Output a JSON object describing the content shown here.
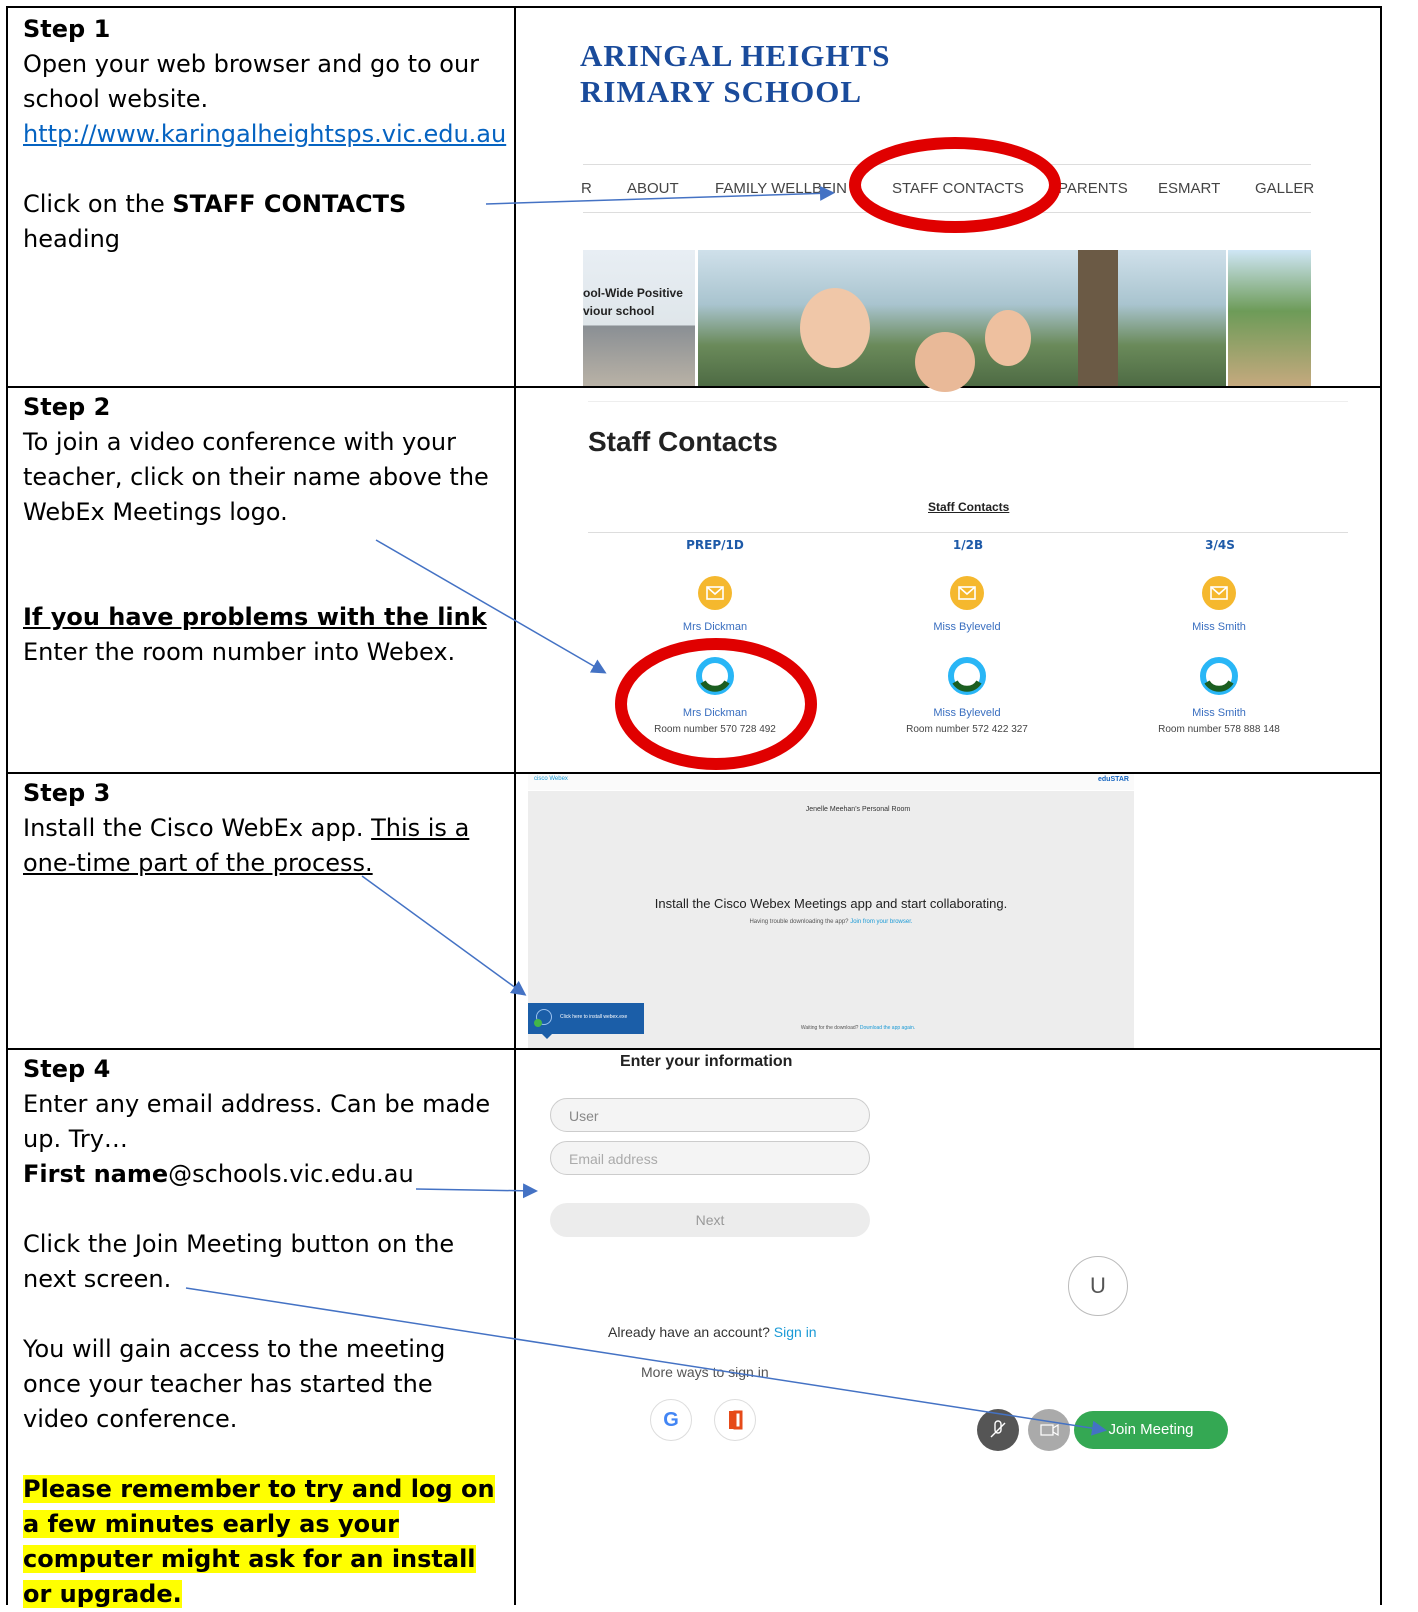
{
  "step1": {
    "title": "Step 1",
    "line1": "Open your web browser and go to our school website.",
    "url": "http://www.karingalheightsps.vic.edu.au",
    "click_pre": "Click on the ",
    "click_bold": "STAFF CONTACTS",
    "click_post": " heading",
    "school_line1": "ARINGAL HEIGHTS",
    "school_line2": "RIMARY SCHOOL",
    "nav": [
      "R",
      "ABOUT",
      "FAMILY WELLBEIN",
      "STAFF CONTACTS",
      "PARENTS",
      "ESMART",
      "GALLER"
    ],
    "banner_text1": "ool-Wide Positive",
    "banner_text2": "viour school"
  },
  "step2": {
    "title": "Step 2",
    "line1": "To join a video conference with your teacher, click on their name above the WebEx Meetings logo.",
    "problem": "If you have problems with the link",
    "line2": "Enter the room number into Webex.",
    "page_title": "Staff Contacts",
    "sub_title": "Staff Contacts",
    "columns": [
      {
        "head": "PREP/1D",
        "teacher": "Mrs Dickman",
        "room": "Room number 570 728 492"
      },
      {
        "head": "1/2B",
        "teacher": "Miss Byleveld",
        "room": "Room number 572 422 327"
      },
      {
        "head": "3/4S",
        "teacher": "Miss Smith",
        "room": "Room number 578 888 148"
      }
    ]
  },
  "step3": {
    "title": "Step 3",
    "line1": "Install the Cisco WebEx app. ",
    "line1_u": "This is a one-time part of the process.",
    "brand": "cisco Webex",
    "edustar": "eduSTAR",
    "room_title": "Jenelle Meehan's Personal Room",
    "install_msg": "Install the Cisco Webex Meetings app and start collaborating.",
    "trouble_pre": "Having trouble downloading the app? ",
    "trouble_link": "Join from your browser.",
    "install_btn": "Click here to install webex.exe",
    "waiting_pre": "Waiting for the download? ",
    "waiting_link": "Download the app again."
  },
  "step4": {
    "title": "Step 4",
    "line1": "Enter any email address. Can be made up. Try…",
    "email_bold": "First name",
    "email_rest": "@schools.vic.edu.au",
    "line2": "Click the Join Meeting button on the next screen.",
    "line3": "You will gain access to the meeting once your teacher has started the video conference.",
    "highlight": "Please remember to try and log on a few minutes early as your computer might ask for an install or upgrade.",
    "form_title": "Enter your information",
    "user_placeholder": "User",
    "email_placeholder": "Email address",
    "next_label": "Next",
    "avatar_letter": "U",
    "account_pre": "Already have an account? ",
    "sign_in": "Sign in",
    "more_ways": "More ways to sign in",
    "join_label": "Join Meeting",
    "colors": {
      "join_green": "#34a853",
      "link_blue": "#1a9ad6",
      "annotation_red": "#e00000"
    }
  }
}
